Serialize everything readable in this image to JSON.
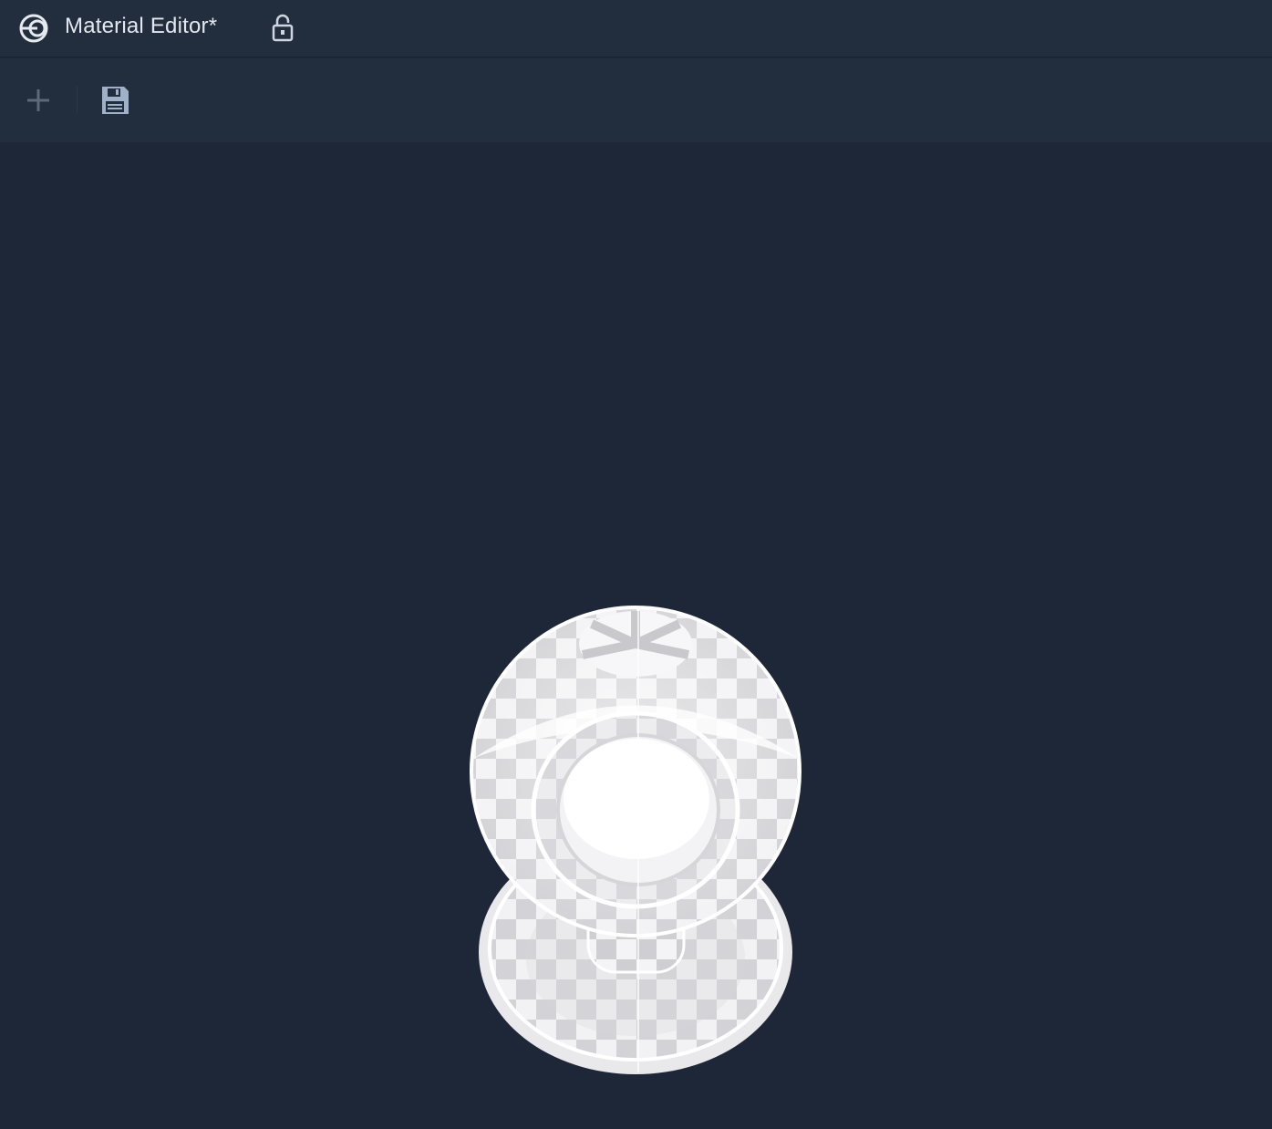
{
  "window": {
    "title": "Material Editor*"
  },
  "icons": {
    "app_logo": "app-logo-icon",
    "lock": "unlock-icon",
    "add": "plus-icon",
    "save": "floppy-disk-icon"
  },
  "colors": {
    "titlebar_bg": "#222d3e",
    "toolbar_bg": "#222d3e",
    "viewport_bg": "#1d2737",
    "title_text": "#e4e8ee",
    "icon_muted": "#5d6878",
    "icon_save": "#9fb0c8",
    "material_tint": "#d9d9dc"
  },
  "viewport": {
    "preview_model": "material-preview-sphere"
  }
}
